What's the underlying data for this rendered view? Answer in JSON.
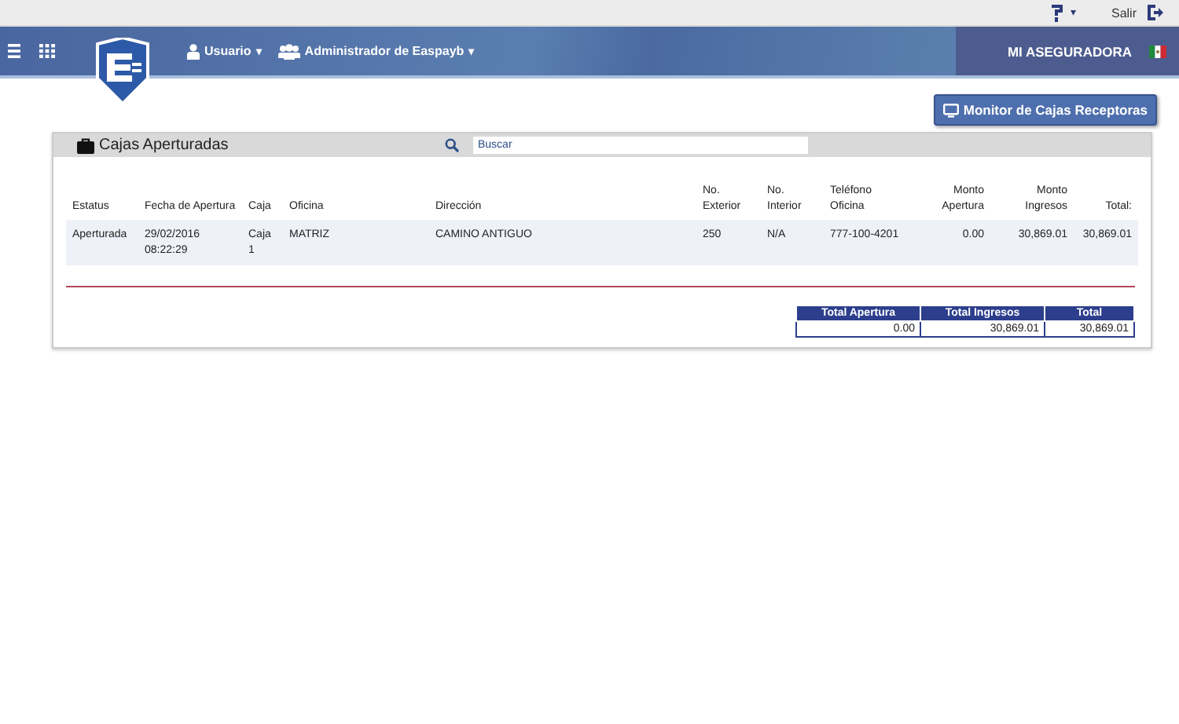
{
  "topbar": {
    "help_caret": "▾",
    "logout": "Salir"
  },
  "header": {
    "menus": [
      {
        "label": "Usuario",
        "caret": "▾"
      },
      {
        "label": "Administrador de Easpayb",
        "caret": "▾"
      }
    ],
    "company": "MI ASEGURADORA"
  },
  "monitor_button": "Monitor de Cajas Receptoras",
  "panel": {
    "title": "Cajas Aperturadas",
    "search": {
      "placeholder": "Buscar"
    },
    "table": {
      "columns": [
        "Estatus",
        "Fecha de Apertura",
        "Caja",
        "Oficina",
        "Dirección",
        "No. Exterior",
        "No. Interior",
        "Teléfono Oficina",
        "Monto Apertura",
        "Monto Ingresos",
        "Total:"
      ],
      "rows": [
        [
          "Aperturada",
          "29/02/2016 08:22:29",
          "Caja 1",
          "MATRIZ",
          "CAMINO ANTIGUO",
          "250",
          "N/A",
          "777-100-4201",
          "0.00",
          "30,869.01",
          "30,869.01"
        ]
      ]
    },
    "totals": {
      "columns": [
        "Total Apertura",
        "Total Ingresos",
        "Total"
      ],
      "values": [
        "0.00",
        "30,869.01",
        "30,869.01"
      ]
    }
  }
}
